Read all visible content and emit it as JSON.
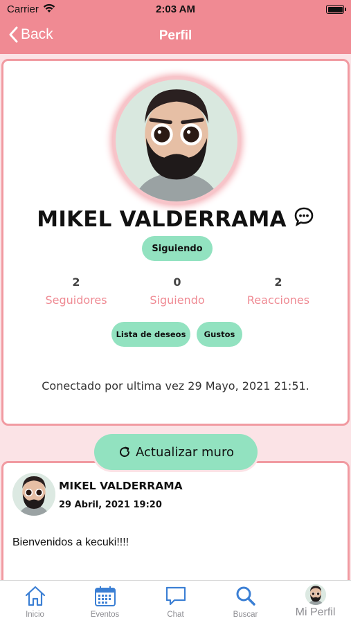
{
  "status_bar": {
    "carrier": "Carrier",
    "time": "2:03 AM"
  },
  "nav": {
    "back_label": "Back",
    "title": "Perfil"
  },
  "profile": {
    "name": "MIKEL VALDERRAMA",
    "follow_button": "Siguiendo",
    "stats": [
      {
        "value": "2",
        "label": "Seguidores"
      },
      {
        "value": "0",
        "label": "Siguiendo"
      },
      {
        "value": "2",
        "label": "Reacciones"
      }
    ],
    "pills": [
      "Lista de deseos",
      "Gustos"
    ],
    "last_seen": "Conectado por ultima vez 29 Mayo, 2021 21:51."
  },
  "refresh_button": "Actualizar muro",
  "post": {
    "author": "MIKEL VALDERRAMA",
    "date": "29 Abril, 2021 19:20",
    "text": "Bienvenidos a kecuki!!!!"
  },
  "tabs": [
    {
      "label": "Inicio",
      "icon": "home-icon"
    },
    {
      "label": "Eventos",
      "icon": "calendar-icon"
    },
    {
      "label": "Chat",
      "icon": "chat-icon"
    },
    {
      "label": "Buscar",
      "icon": "search-icon"
    },
    {
      "label": "Mi Perfil",
      "icon": "avatar"
    }
  ],
  "colors": {
    "header": "#f08a93",
    "accent_green": "#92e2c0",
    "accent_pink": "#ef8a93",
    "tab_blue": "#3b7fd4",
    "background": "#fbe3e6"
  }
}
